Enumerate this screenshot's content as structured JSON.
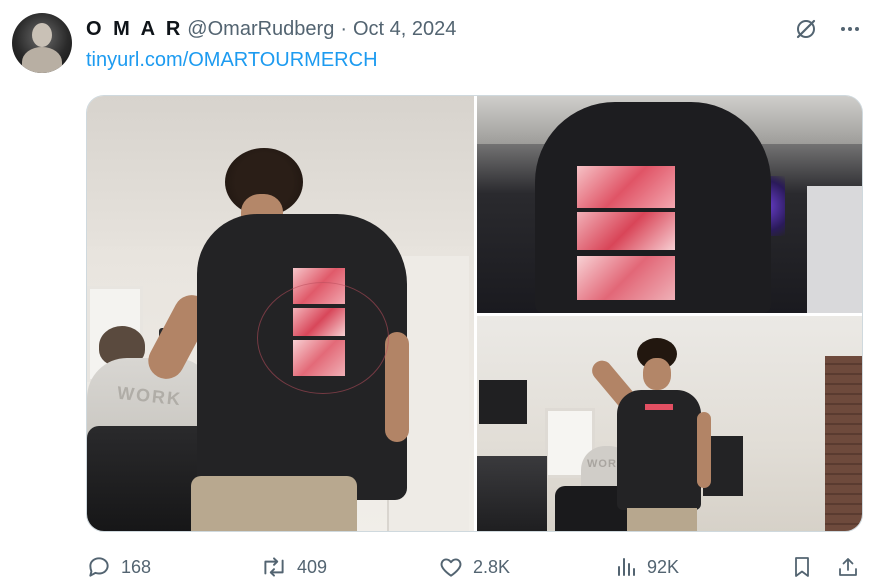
{
  "post": {
    "display_name": "O M A R",
    "handle": "@OmarRudberg",
    "separator": "·",
    "date": "Oct 4, 2024",
    "link_text": "tinyurl.com/OMARTOURMERCH"
  },
  "media": {
    "photo_1_shirt_text": "WORK",
    "photo_3_shirt_text": "WORK"
  },
  "actions": {
    "replies": "168",
    "reposts": "409",
    "likes": "2.8K",
    "views": "92K"
  },
  "colors": {
    "link": "#1d9bf0",
    "muted": "#536471",
    "text": "#0f1419"
  },
  "icons": [
    "grok-icon",
    "more-icon",
    "reply-icon",
    "repost-icon",
    "like-icon",
    "views-icon",
    "bookmark-icon",
    "share-icon"
  ]
}
